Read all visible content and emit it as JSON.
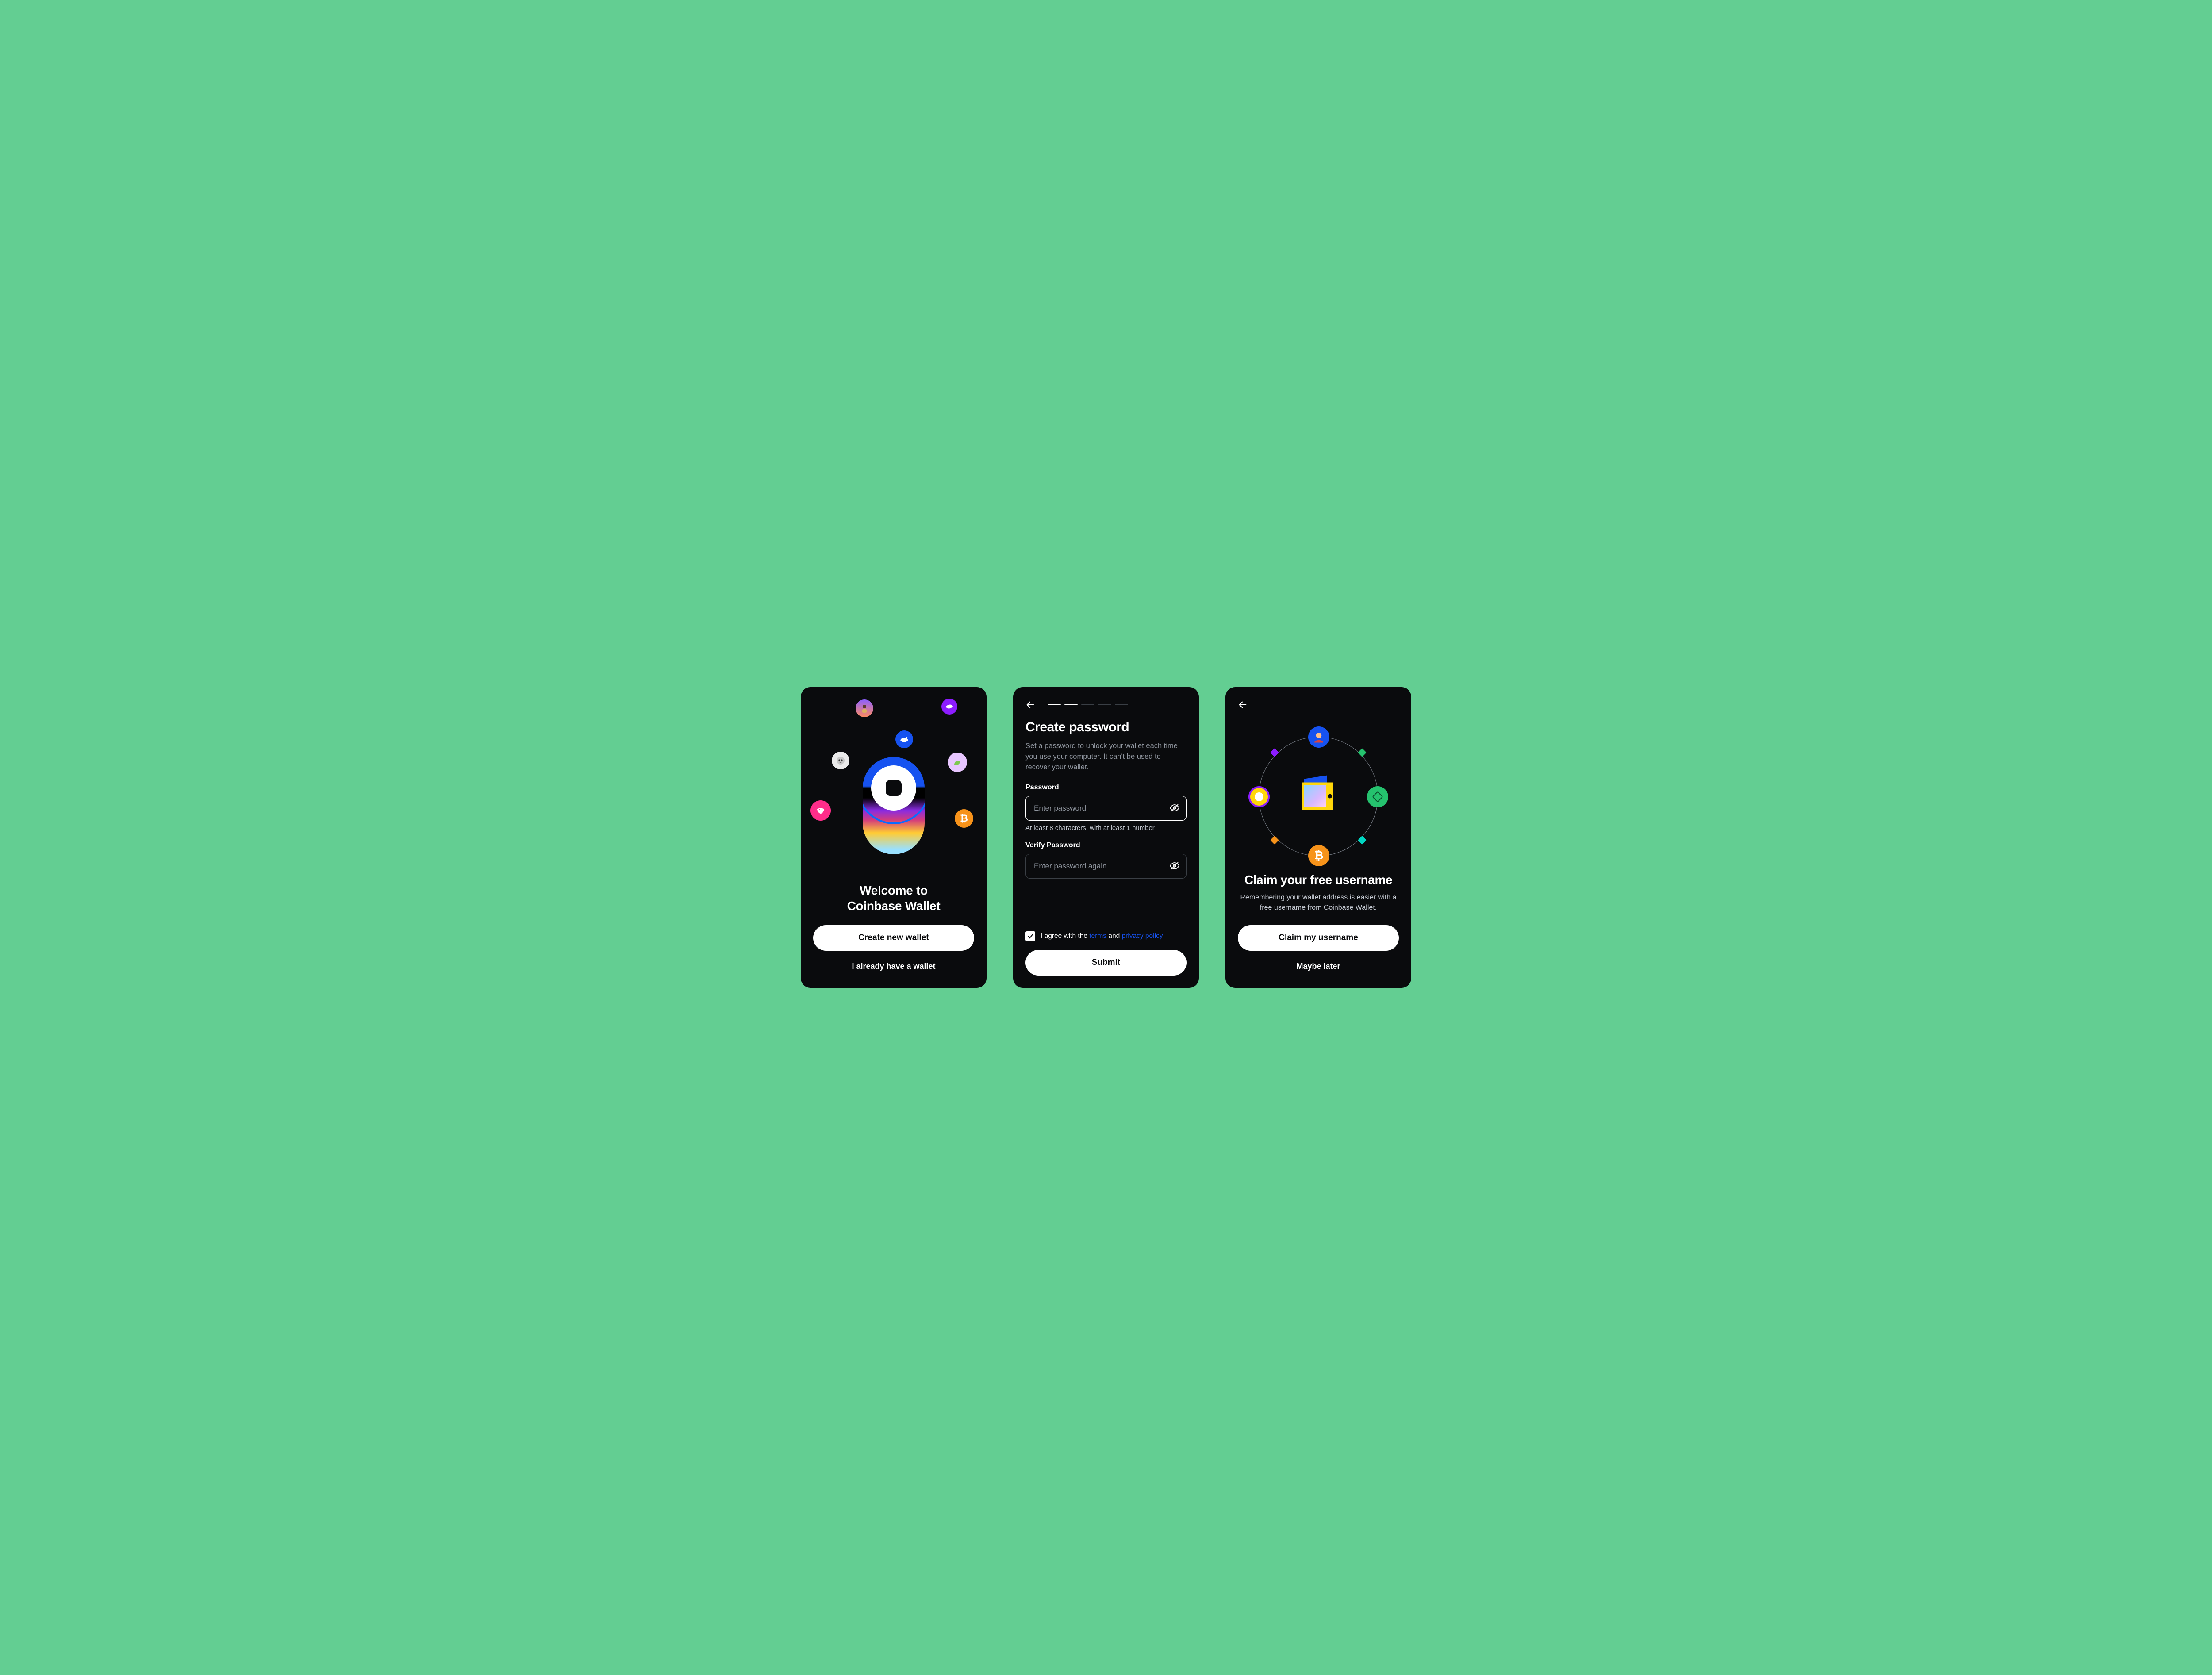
{
  "screen1": {
    "title_line1": "Welcome to",
    "title_line2": "Coinbase Wallet",
    "primary_button": "Create new wallet",
    "secondary_button": "I already have a wallet"
  },
  "screen2": {
    "progress": {
      "total": 5,
      "current": 2
    },
    "heading": "Create password",
    "description": "Set a password to unlock your wallet each time you use your computer. It can't be used to recover your wallet.",
    "password_label": "Password",
    "password_placeholder": "Enter password",
    "password_hint": "At least 8 characters, with at least 1 number",
    "verify_label": "Verify Password",
    "verify_placeholder": "Enter password again",
    "agree_prefix": "I agree with the ",
    "terms_link": "terms",
    "agree_mid": " and ",
    "privacy_link": "privacy policy",
    "agree_checked": true,
    "submit_button": "Submit"
  },
  "screen3": {
    "heading": "Claim your free username",
    "description": "Remembering your wallet address is easier with a free username from Coinbase Wallet.",
    "primary_button": "Claim my username",
    "secondary_button": "Maybe later"
  },
  "colors": {
    "blue": "#1652f0",
    "orange": "#f7931a",
    "pink": "#ff2d8a",
    "purple": "#8c1cff",
    "teal": "#00d6c1",
    "green": "#25c26e",
    "yellow": "#ffd60a"
  },
  "icons": {
    "back": "back-arrow-icon",
    "eye_off": "eye-off-icon",
    "check": "check-icon",
    "bitcoin": "bitcoin-icon",
    "whale": "whale-icon",
    "ape": "ape-avatar-icon",
    "woman": "woman-avatar-icon",
    "dino": "dino-avatar-icon",
    "bull": "bull-icon",
    "bird": "bird-icon",
    "hood": "hooded-avatar-icon",
    "sun": "sun-token-icon",
    "diamond_badge": "diamond-badge-icon",
    "wallet": "wallet-art-icon"
  }
}
